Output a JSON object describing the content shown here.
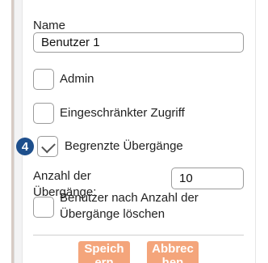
{
  "form": {
    "name_label": "Name",
    "name_value": "Benutzer 1",
    "admin_label": "Admin",
    "restricted_access_label": "Eingeschränkter Zugriff",
    "limited_transitions_label": "Begrenzte Übergänge",
    "limited_transitions_checked": true,
    "transition_count_label": "Anzahl der Übergänge:",
    "transition_count_value": "10",
    "delete_user_label_line1": "Benutzer nach Anzahl der",
    "delete_user_label_line2": "Übergänge löschen",
    "step_badge": "4"
  },
  "buttons": {
    "save_label": "Speichern",
    "cancel_label": "Abbrechen"
  },
  "colors": {
    "button_bg": "#f4a57b",
    "badge_bg": "#1e4f8c"
  }
}
